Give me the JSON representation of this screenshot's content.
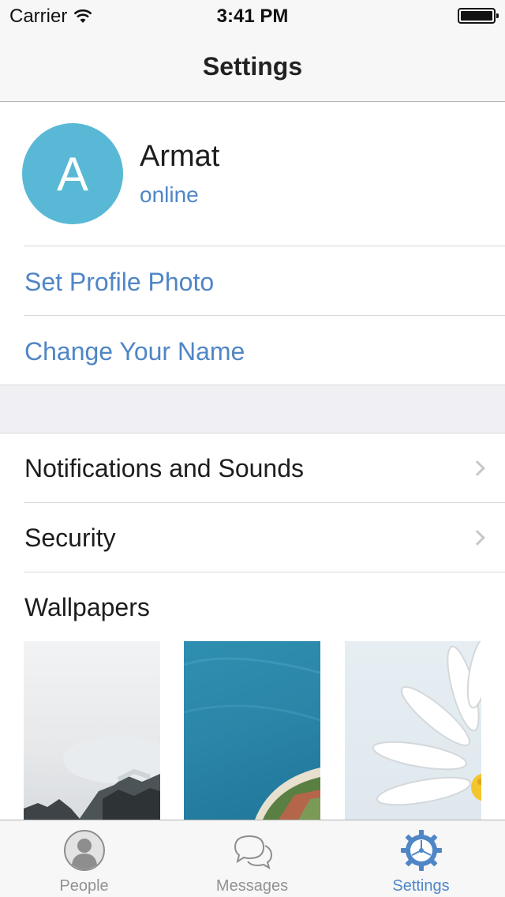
{
  "status_bar": {
    "carrier": "Carrier",
    "time": "3:41 PM"
  },
  "nav": {
    "title": "Settings"
  },
  "profile": {
    "avatar_letter": "A",
    "name": "Armat",
    "status": "online",
    "avatar_color": "#59b8d6"
  },
  "profile_actions": [
    {
      "label": "Set Profile Photo"
    },
    {
      "label": "Change Your Name"
    }
  ],
  "settings_rows": [
    {
      "label": "Notifications and Sounds",
      "icon": "chevron-right-icon"
    },
    {
      "label": "Security",
      "icon": "chevron-right-icon"
    }
  ],
  "wallpapers": {
    "title": "Wallpapers",
    "items": [
      "mountain",
      "ocean",
      "flower"
    ]
  },
  "tab_bar": {
    "tabs": [
      {
        "label": "People",
        "icon": "person-icon",
        "active": false
      },
      {
        "label": "Messages",
        "icon": "chat-bubbles-icon",
        "active": false
      },
      {
        "label": "Settings",
        "icon": "gear-icon",
        "active": true
      }
    ]
  },
  "colors": {
    "accent": "#4f86c6",
    "separator": "#d9d9d9",
    "group_bg": "#efeff4"
  }
}
